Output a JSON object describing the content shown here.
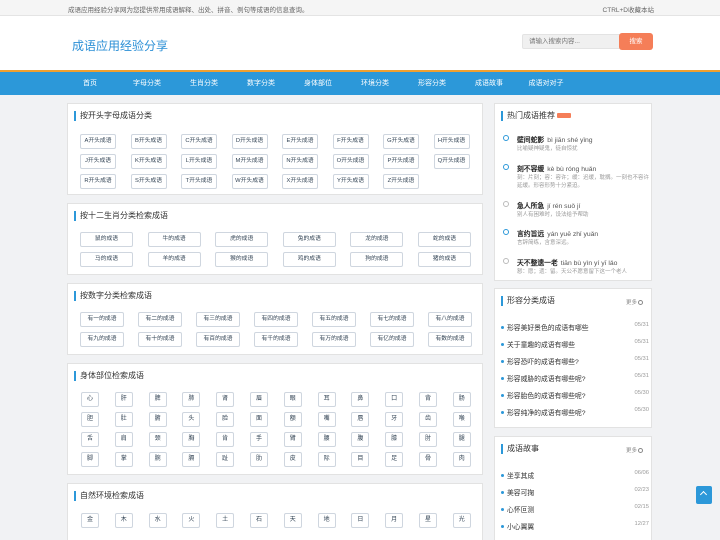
{
  "topbar": {
    "intro": "成语应用经验分享网为您提供常用成语解释、出处、拼音、例句等成语的信息查询。",
    "favorite": "CTRL+D收藏本站"
  },
  "header": {
    "logo": "成语应用经验分享",
    "search_placeholder": "请输入搜索内容...",
    "search_button": "搜索"
  },
  "nav": {
    "items": [
      "首页",
      "字母分类",
      "生肖分类",
      "数字分类",
      "身体部位",
      "环境分类",
      "形容分类",
      "成语故事",
      "成语对对子"
    ],
    "dropdown_icon": "caret-down-icon"
  },
  "letters": {
    "title": "按开头字母成语分类",
    "items": [
      "A开头成语",
      "B开头成语",
      "C开头成语",
      "D开头成语",
      "E开头成语",
      "F开头成语",
      "G开头成语",
      "H开头成语",
      "J开头成语",
      "K开头成语",
      "L开头成语",
      "M开头成语",
      "N开头成语",
      "O开头成语",
      "P开头成语",
      "Q开头成语",
      "R开头成语",
      "S开头成语",
      "T开头成语",
      "W开头成语",
      "X开头成语",
      "Y开头成语",
      "Z开头成语"
    ]
  },
  "zodiac": {
    "title": "按十二生肖分类检索成语",
    "items": [
      "鼠的成语",
      "牛的成语",
      "虎的成语",
      "兔的成语",
      "龙的成语",
      "蛇的成语",
      "马的成语",
      "羊的成语",
      "猴的成语",
      "鸡的成语",
      "狗的成语",
      "猪的成语"
    ]
  },
  "numbers": {
    "title": "按数字分类检索成语",
    "items": [
      "有一的成语",
      "有二的成语",
      "有三的成语",
      "有四的成语",
      "有五的成语",
      "有七的成语",
      "有八的成语",
      "有九的成语",
      "有十的成语",
      "有百的成语",
      "有千的成语",
      "有万的成语",
      "有亿的成语",
      "有数的成语"
    ]
  },
  "body": {
    "title": "身体部位检索成语",
    "items": [
      "心",
      "肝",
      "脾",
      "肺",
      "肾",
      "眉",
      "眼",
      "耳",
      "鼻",
      "口",
      "背",
      "肠",
      "胆",
      "肚",
      "腑",
      "头",
      "脸",
      "面",
      "额",
      "嘴",
      "唇",
      "牙",
      "齿",
      "喉",
      "舌",
      "肩",
      "颈",
      "胸",
      "肯",
      "手",
      "臂",
      "腰",
      "腹",
      "膝",
      "肘",
      "腿",
      "脚",
      "掌",
      "腕",
      "膈",
      "趾",
      "肋",
      "皮",
      "际",
      "目",
      "足",
      "骨",
      "肉"
    ]
  },
  "nature": {
    "title": "自然环境检索成语",
    "items": [
      "金",
      "木",
      "水",
      "火",
      "土",
      "石",
      "天",
      "地",
      "日",
      "月",
      "星",
      "光"
    ]
  },
  "hot": {
    "title": "热门成语推荐",
    "items": [
      {
        "word": "壁间蛇影",
        "pinyin": "bì jiān shé yǐng",
        "desc": "比喻疑神疑鬼，徒自惊扰"
      },
      {
        "word": "刻不容缓",
        "pinyin": "kè bù róng huǎn",
        "desc": "刻：片刻；容：容许；缓：迟缓，耽搁。一刻也不容许延缓。形容形势十分紧迫。"
      },
      {
        "word": "急人所急",
        "pinyin": "jí rén suǒ jí",
        "desc": "别人有困难时，设法给予帮助"
      },
      {
        "word": "言约旨远",
        "pinyin": "yán yuē zhǐ yuǎn",
        "desc": "言辞简练，含意深远。"
      },
      {
        "word": "天不整遗一老",
        "pinyin": "tiān bù yìn yí yī lǎo",
        "desc": "憖：愿；遗：留。天公不愿意留下这一个老人"
      }
    ]
  },
  "describe": {
    "title": "形容分类成语",
    "more": "更多",
    "items": [
      {
        "text": "形容美好景色的成语有哪些",
        "date": "05/31"
      },
      {
        "text": "关于童趣的成语有哪些",
        "date": "05/31"
      },
      {
        "text": "形容恐吓的成语有哪些?",
        "date": "05/31"
      },
      {
        "text": "形容威胁的成语有哪些呢?",
        "date": "05/31"
      },
      {
        "text": "形容胎色的成语有哪些呢?",
        "date": "05/30"
      },
      {
        "text": "形容纯净的成语有哪些呢?",
        "date": "05/30"
      }
    ]
  },
  "stories": {
    "title": "成语故事",
    "more": "更多",
    "items": [
      {
        "text": "坐享其成",
        "date": "06/06"
      },
      {
        "text": "美容可掬",
        "date": "02/23"
      },
      {
        "text": "心怀叵测",
        "date": "02/15"
      },
      {
        "text": "小心翼翼",
        "date": "12/27"
      }
    ]
  },
  "colors": {
    "accent": "#2c98d9",
    "nav_top_border": "#f0a030",
    "search_button": "#f57e58"
  }
}
